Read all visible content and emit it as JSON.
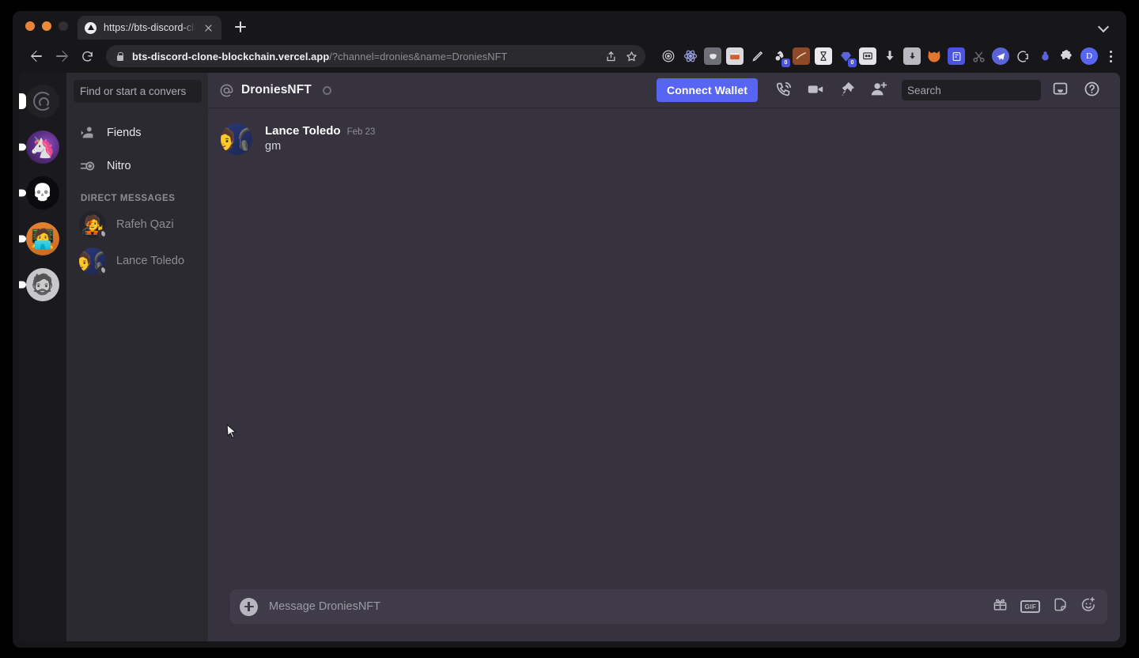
{
  "browser": {
    "tab": {
      "title": "https://bts-discord-clone-bloc",
      "favicon": "vercel-triangle-icon",
      "close_label": ""
    },
    "new_tab_label": "",
    "url": {
      "host": "bts-discord-clone-blockchain.vercel.app",
      "path": "/?channel=dronies&name=DroniesNFT"
    },
    "profile_initial": "D",
    "extension_badges": [
      "0",
      "0"
    ]
  },
  "rail": {
    "servers": [
      {
        "name": "dronies-server",
        "active": true
      },
      {
        "name": "unicorn-server",
        "active": false
      },
      {
        "name": "skull-server",
        "active": false
      },
      {
        "name": "orange-avatar-server",
        "active": false
      },
      {
        "name": "gray-avatar-server",
        "active": false
      }
    ]
  },
  "sidebar": {
    "search_placeholder": "Find or start a convers",
    "nav": [
      {
        "label": "Fiends",
        "icon": "friends-icon"
      },
      {
        "label": "Nitro",
        "icon": "nitro-icon"
      }
    ],
    "dm_header": "DIRECT MESSAGES",
    "dms": [
      {
        "name": "Rafeh Qazi",
        "status": "idle"
      },
      {
        "name": "Lance Toledo",
        "status": "idle"
      }
    ]
  },
  "header": {
    "channel_prefix": "@",
    "channel_name": "DroniesNFT",
    "wallet_button": "Connect Wallet",
    "search_placeholder": "Search",
    "icons": [
      "call-icon",
      "video-icon",
      "pin-icon",
      "add-person-icon",
      "inbox-icon",
      "help-icon"
    ]
  },
  "messages": [
    {
      "author": "Lance Toledo",
      "time": "Feb 23",
      "text": "gm"
    }
  ],
  "composer": {
    "placeholder": "Message DroniesNFT",
    "gif_label": "GIF",
    "icons": [
      "plus-icon",
      "gift-icon",
      "gif-icon",
      "sticker-icon",
      "emoji-icon"
    ]
  },
  "colors": {
    "accent": "#5865f2",
    "main_bg": "#36323e",
    "sidebar_bg": "#2b2a31",
    "rail_bg": "#1a1a1e",
    "composer_bg": "#403b49"
  }
}
